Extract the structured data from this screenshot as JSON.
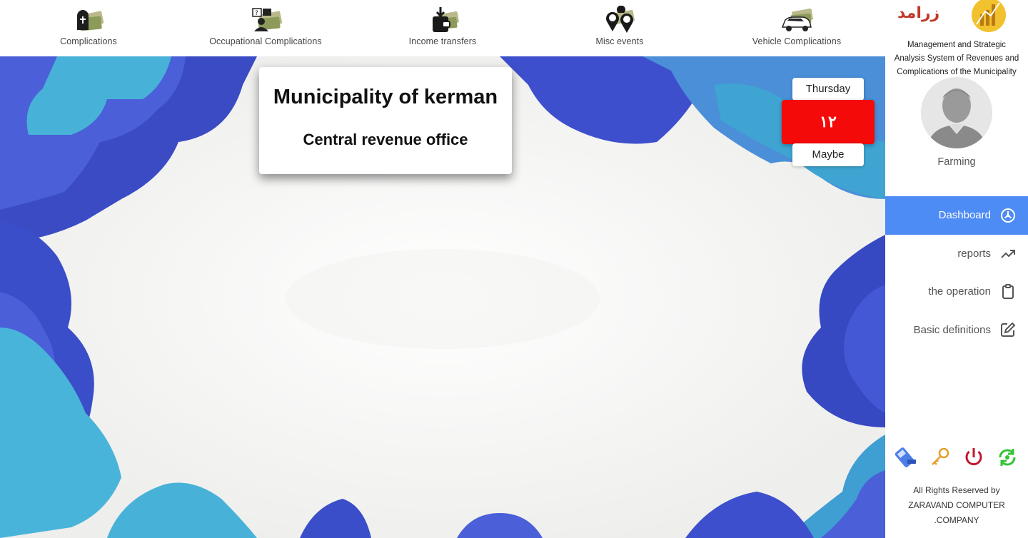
{
  "topnav": {
    "items": [
      {
        "label": "Complications",
        "icon": "tombstone-money-icon"
      },
      {
        "label": "Occupational Complications",
        "icon": "worker-money-icon"
      },
      {
        "label": "Income transfers",
        "icon": "transfer-money-icon"
      },
      {
        "label": "Misc events",
        "icon": "map-pins-money-icon"
      },
      {
        "label": "Vehicle Complications",
        "icon": "car-money-icon"
      }
    ]
  },
  "header": {
    "title": "Municipality of kerman",
    "subtitle": "Central revenue office"
  },
  "date": {
    "weekday": "Thursday",
    "day": "۱۲",
    "month": "Maybe"
  },
  "sidebar": {
    "logo_text": "زرامد",
    "app_title_lines": [
      "Management and Strategic",
      "Analysis System of Revenues and",
      "Complications of the Municipality"
    ],
    "user_name": "Farming",
    "menu": [
      {
        "label": "Dashboard",
        "icon": "dashboard-gauge-icon",
        "active": true
      },
      {
        "label": "reports",
        "icon": "trending-up-icon",
        "active": false
      },
      {
        "label": "the operation",
        "icon": "clipboard-icon",
        "active": false
      },
      {
        "label": "Basic definitions",
        "icon": "edit-icon",
        "active": false
      }
    ],
    "tools": [
      {
        "icon": "pos-terminal-icon",
        "color": "#4d7ee8"
      },
      {
        "icon": "key-icon",
        "color": "#e3a02a"
      },
      {
        "icon": "power-icon",
        "color": "#c0182e"
      },
      {
        "icon": "refresh-icon",
        "color": "#36c236"
      }
    ],
    "copyright_lines": [
      "All Rights Reserved by",
      "ZARAVAND COMPUTER",
      ".COMPANY"
    ]
  },
  "colors": {
    "accent": "#4d8bf5",
    "date_red": "#f50a0a",
    "puzzle_dark": "#3b4ec9",
    "puzzle_light": "#47b0d6"
  }
}
